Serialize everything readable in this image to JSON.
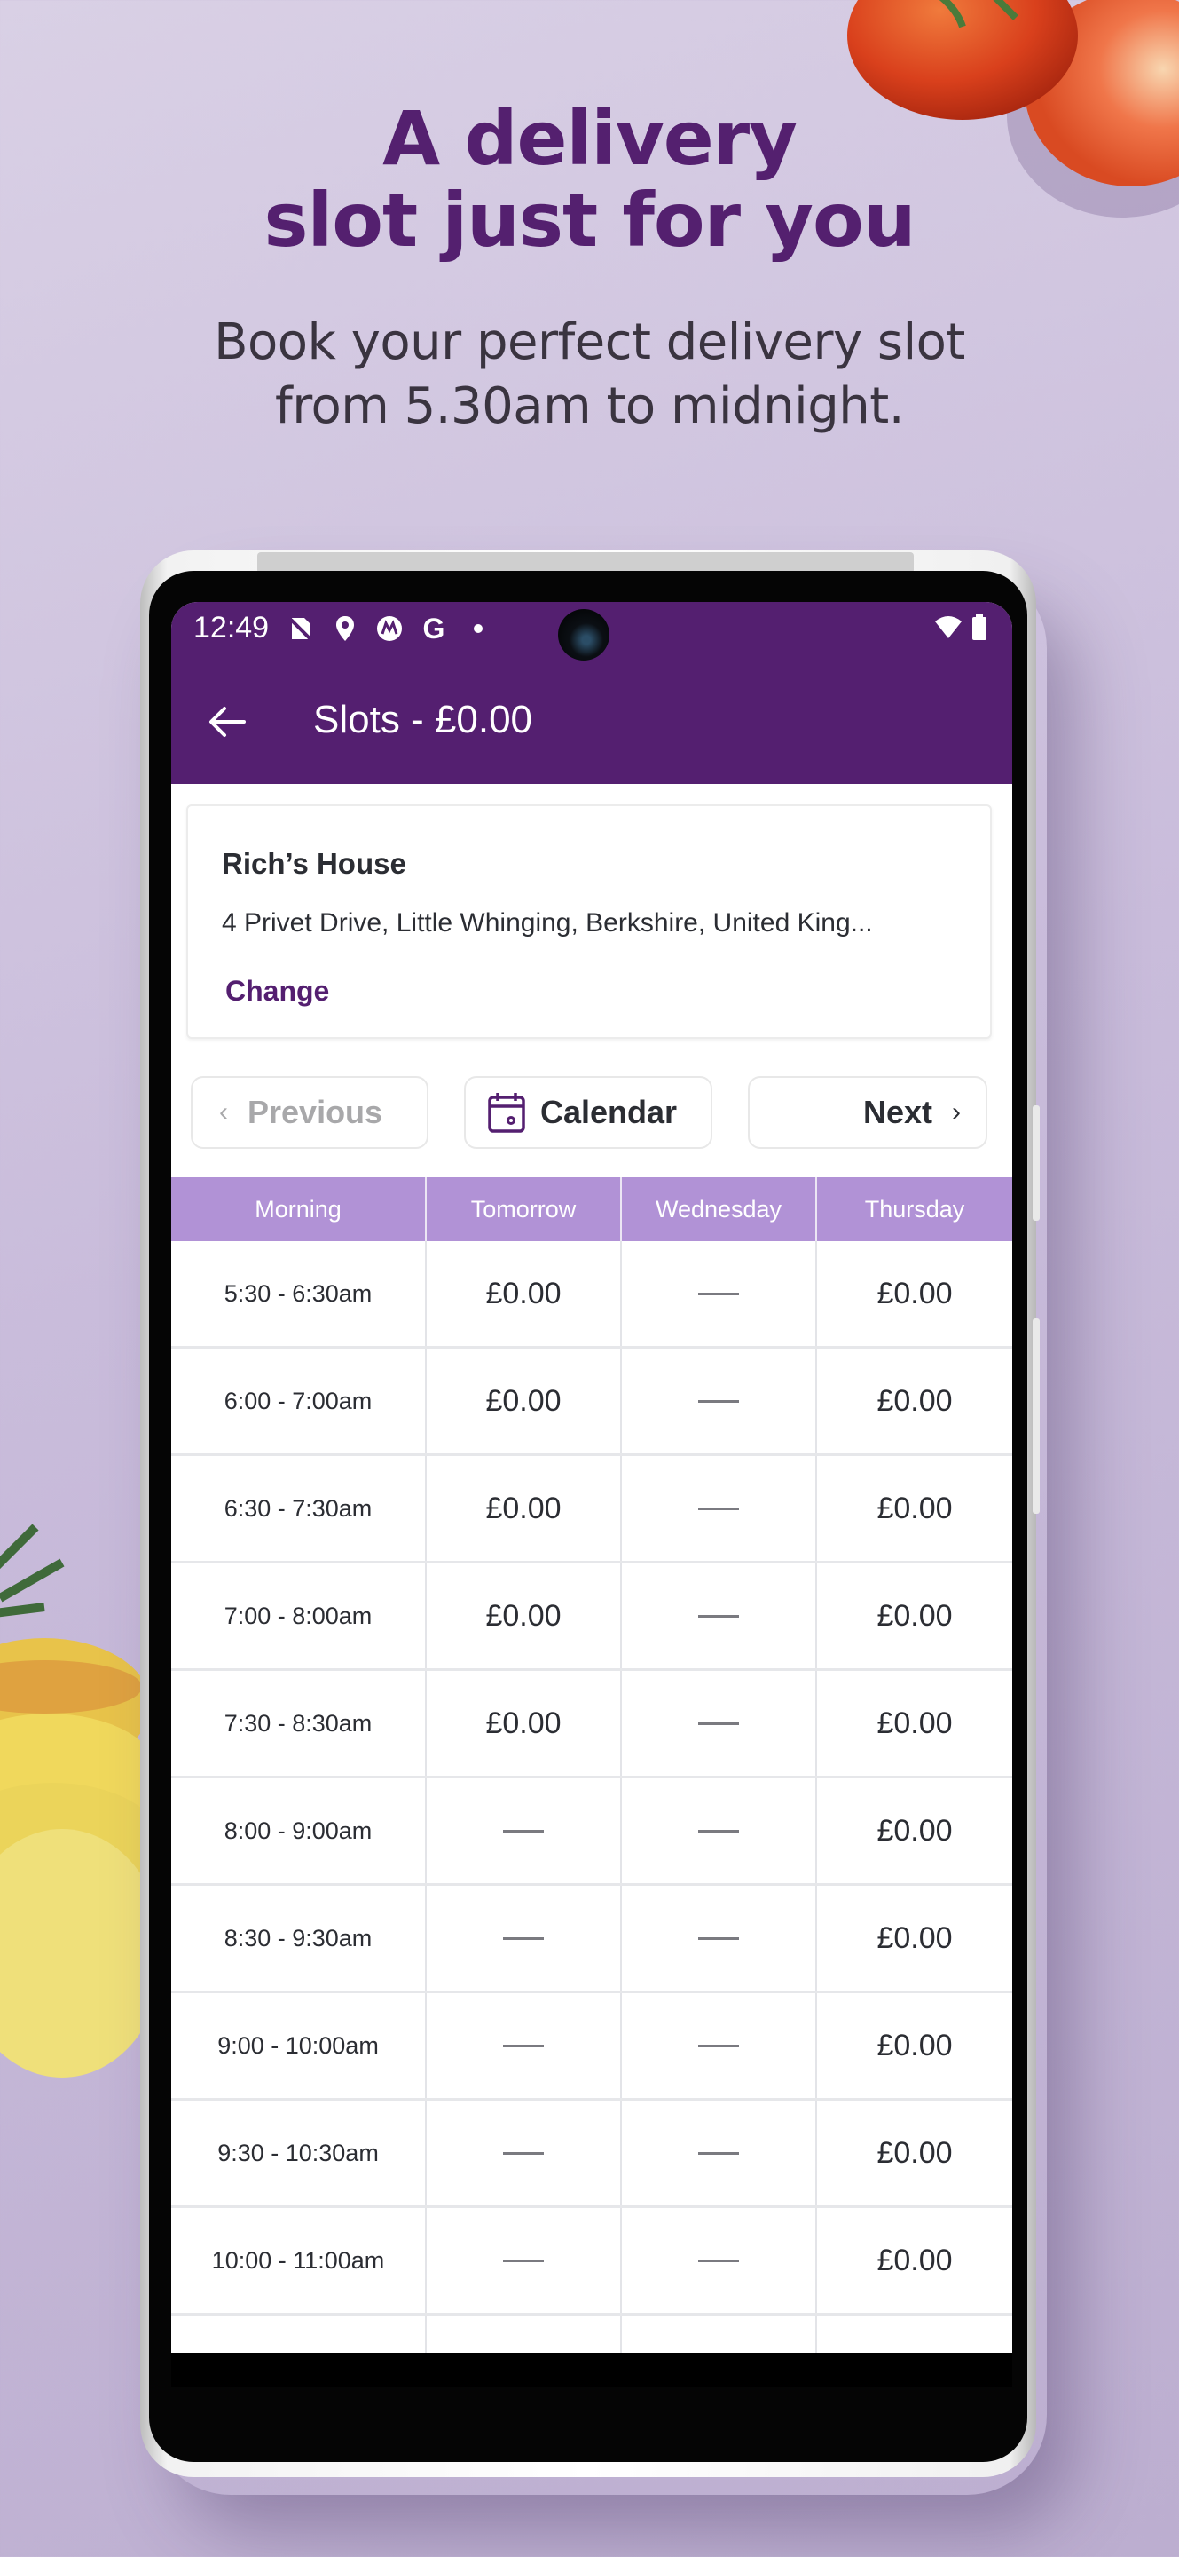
{
  "promo": {
    "headline_line1": "A delivery",
    "headline_line2": "slot just for you",
    "subline_line1": "Book your perfect delivery slot",
    "subline_line2": "from 5.30am to midnight."
  },
  "status_bar": {
    "time": "12:49",
    "icons": [
      "no-sim-icon",
      "location-icon",
      "motorola-icon",
      "google-icon",
      "dot-icon",
      "wifi-icon",
      "battery-icon"
    ]
  },
  "app_bar": {
    "back_icon": "arrow-left-icon",
    "title": "Slots - £0.00"
  },
  "address": {
    "name": "Rich’s House",
    "line": "4 Privet Drive, Little Whinging, Berkshire, United King...",
    "change_label": "Change"
  },
  "nav": {
    "previous_label": "Previous",
    "calendar_label": "Calendar",
    "next_label": "Next"
  },
  "colors": {
    "brand": "#541f70",
    "header_bg": "#b192d6",
    "page_bg": "#cfc3df"
  },
  "table": {
    "headers": [
      "Morning",
      "Tomorrow",
      "Wednesday",
      "Thursday"
    ],
    "rows": [
      {
        "time": "5:30 - 6:30am",
        "tomorrow": "£0.00",
        "wednesday": "—",
        "thursday": "£0.00"
      },
      {
        "time": "6:00 - 7:00am",
        "tomorrow": "£0.00",
        "wednesday": "—",
        "thursday": "£0.00"
      },
      {
        "time": "6:30 - 7:30am",
        "tomorrow": "£0.00",
        "wednesday": "—",
        "thursday": "£0.00"
      },
      {
        "time": "7:00 - 8:00am",
        "tomorrow": "£0.00",
        "wednesday": "—",
        "thursday": "£0.00"
      },
      {
        "time": "7:30 - 8:30am",
        "tomorrow": "£0.00",
        "wednesday": "—",
        "thursday": "£0.00"
      },
      {
        "time": "8:00 - 9:00am",
        "tomorrow": "—",
        "wednesday": "—",
        "thursday": "£0.00"
      },
      {
        "time": "8:30 - 9:30am",
        "tomorrow": "—",
        "wednesday": "—",
        "thursday": "£0.00"
      },
      {
        "time": "9:00 - 10:00am",
        "tomorrow": "—",
        "wednesday": "—",
        "thursday": "£0.00"
      },
      {
        "time": "9:30 - 10:30am",
        "tomorrow": "—",
        "wednesday": "—",
        "thursday": "£0.00"
      },
      {
        "time": "10:00 - 11:00am",
        "tomorrow": "—",
        "wednesday": "—",
        "thursday": "£0.00"
      },
      {
        "time": "",
        "tomorrow": "",
        "wednesday": "",
        "thursday": ""
      }
    ]
  }
}
